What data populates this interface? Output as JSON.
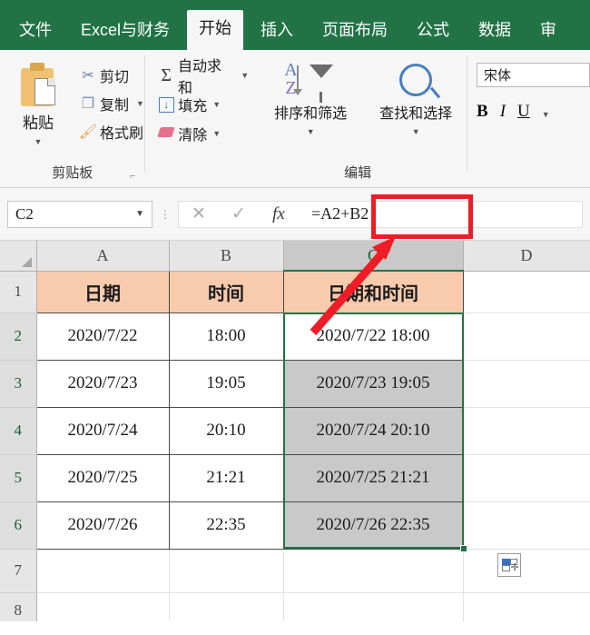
{
  "ribbon": {
    "tabs": [
      {
        "label": "文件",
        "active": false
      },
      {
        "label": "Excel与财务",
        "active": false
      },
      {
        "label": "开始",
        "active": true
      },
      {
        "label": "插入",
        "active": false
      },
      {
        "label": "页面布局",
        "active": false
      },
      {
        "label": "公式",
        "active": false
      },
      {
        "label": "数据",
        "active": false
      },
      {
        "label": "审",
        "active": false
      }
    ],
    "clipboard": {
      "group_label": "剪贴板",
      "paste_label": "粘贴",
      "cut_label": "剪切",
      "copy_label": "复制",
      "format_painter_label": "格式刷",
      "dialog_launcher": "⌐"
    },
    "editing": {
      "group_label": "编辑",
      "autosum_label": "自动求和",
      "fill_label": "填充",
      "clear_label": "清除",
      "sort_filter_label": "排序和筛选",
      "find_select_label": "查找和选择"
    },
    "font": {
      "font_name": "宋体",
      "bold": "B",
      "italic": "I",
      "underline": "U"
    }
  },
  "formula_bar": {
    "name_box_value": "C2",
    "cancel_icon": "✕",
    "enter_icon": "✓",
    "fx_icon": "fx",
    "formula_value": "=A2+B2"
  },
  "grid": {
    "column_headers": [
      "A",
      "B",
      "C",
      "D"
    ],
    "selected_column": "C",
    "row_headers": [
      "1",
      "2",
      "3",
      "4",
      "5",
      "6",
      "7",
      "8"
    ],
    "header_row": [
      "日期",
      "时间",
      "日期和时间"
    ],
    "rows": [
      {
        "row": "2",
        "a": "2020/7/22",
        "b": "18:00",
        "c": "2020/7/22  18:00",
        "c_fill": "white"
      },
      {
        "row": "3",
        "a": "2020/7/23",
        "b": "19:05",
        "c": "2020/7/23  19:05",
        "c_fill": "grey"
      },
      {
        "row": "4",
        "a": "2020/7/24",
        "b": "20:10",
        "c": "2020/7/24  20:10",
        "c_fill": "grey"
      },
      {
        "row": "5",
        "a": "2020/7/25",
        "b": "21:21",
        "c": "2020/7/25  21:21",
        "c_fill": "grey"
      },
      {
        "row": "6",
        "a": "2020/7/26",
        "b": "22:35",
        "c": "2020/7/26  22:35",
        "c_fill": "grey"
      }
    ]
  },
  "annotations": {
    "highlight_target": "=A2+B2",
    "highlight_color": "#ee1c25",
    "arrow_color": "#ee1c25"
  },
  "colors": {
    "excel_green": "#217346",
    "header_fill": "#f8cbad",
    "selection_fill": "#c9c9c9",
    "selection_border": "#217346"
  }
}
